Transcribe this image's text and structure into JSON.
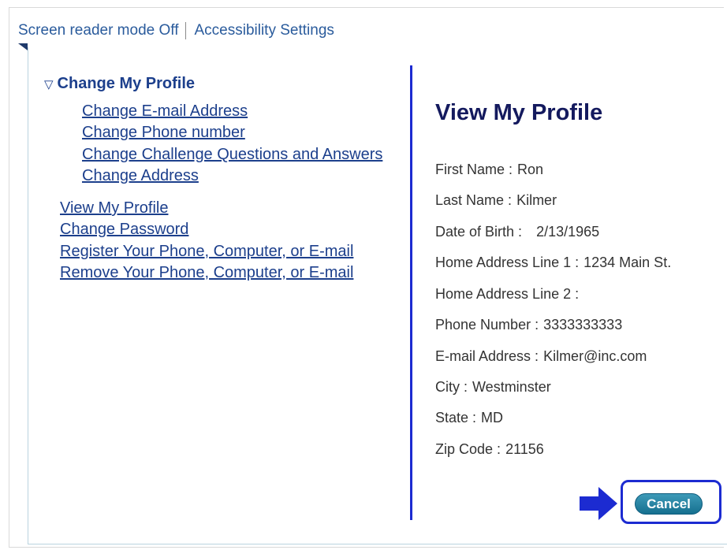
{
  "top_bar": {
    "screen_reader": "Screen reader mode Off",
    "accessibility": "Accessibility Settings"
  },
  "nav": {
    "heading": "Change My Profile",
    "heading_icon": "triangle-down-icon",
    "sub_links": [
      "Change E-mail Address",
      "Change Phone number",
      "Change Challenge Questions and Answers",
      "Change Address"
    ],
    "links": [
      "View My Profile",
      "Change Password",
      "Register Your Phone, Computer, or E-mail",
      "Remove Your Phone, Computer, or E-mail"
    ]
  },
  "profile": {
    "title": "View My Profile",
    "separator": ":",
    "fields": [
      {
        "label": "First Name",
        "value": "Ron"
      },
      {
        "label": "Last Name",
        "value": "Kilmer"
      },
      {
        "label": "Date of Birth",
        "value": "2/13/1965"
      },
      {
        "label": "Home Address Line 1",
        "value": "1234 Main St."
      },
      {
        "label": "Home Address Line 2",
        "value": ""
      },
      {
        "label": "Phone Number",
        "value": "3333333333"
      },
      {
        "label": "E-mail Address",
        "value": "Kilmer@inc.com"
      },
      {
        "label": "City",
        "value": "Westminster"
      },
      {
        "label": "State",
        "value": "MD"
      },
      {
        "label": "Zip Code",
        "value": "21156"
      }
    ]
  },
  "actions": {
    "cancel_label": "Cancel",
    "arrow_icon": "arrow-right-icon"
  },
  "colors": {
    "link": "#1c3f8c",
    "divider": "#1c2bd1",
    "title": "#141a5e",
    "button": "#16708f"
  }
}
